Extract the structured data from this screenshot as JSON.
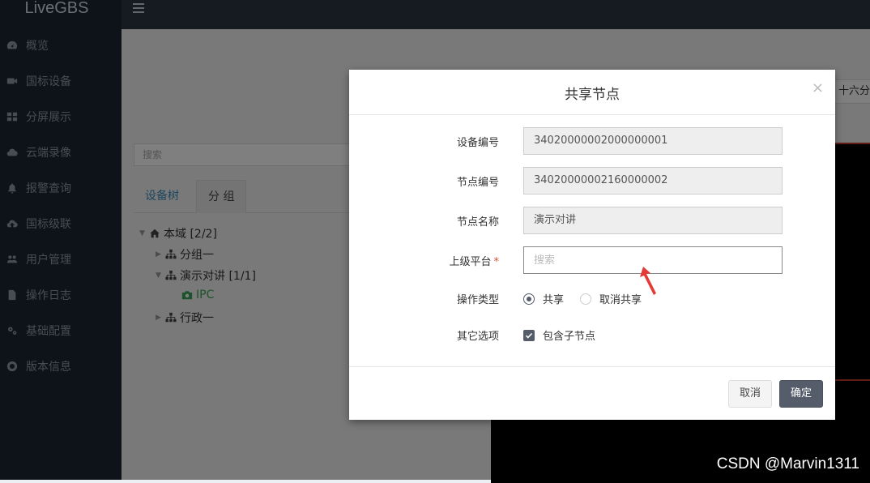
{
  "app": {
    "title": "LiveGBS"
  },
  "sidebar": {
    "items": [
      {
        "label": "概览",
        "icon": "dashboard-icon"
      },
      {
        "label": "国标设备",
        "icon": "video-camera-icon"
      },
      {
        "label": "分屏展示",
        "icon": "grid-icon"
      },
      {
        "label": "云端录像",
        "icon": "cloud-icon"
      },
      {
        "label": "报警查询",
        "icon": "bell-icon"
      },
      {
        "label": "国标级联",
        "icon": "cloud-upload-icon"
      },
      {
        "label": "用户管理",
        "icon": "users-icon"
      },
      {
        "label": "操作日志",
        "icon": "file-icon"
      },
      {
        "label": "基础配置",
        "icon": "gears-icon"
      },
      {
        "label": "版本信息",
        "icon": "lifebuoy-icon"
      }
    ]
  },
  "main": {
    "search_placeholder": "搜索",
    "tabs": [
      {
        "label": "设备树"
      },
      {
        "label": "分 组"
      }
    ],
    "tree": {
      "root": "本域 [2/2]",
      "group1": "分组一",
      "group2": "演示对讲 [1/1]",
      "ipc": "IPC",
      "group3": "行政一"
    },
    "right_button": "十六分"
  },
  "modal": {
    "title": "共享节点",
    "close_glyph": "×",
    "fields": {
      "device_id_label": "设备编号",
      "device_id_value": "34020000002000000001",
      "node_id_label": "节点编号",
      "node_id_value": "34020000002160000002",
      "node_name_label": "节点名称",
      "node_name_value": "演示对讲",
      "parent_label": "上级平台",
      "required_mark": "*",
      "parent_placeholder": "搜索",
      "parent_value": "",
      "op_type_label": "操作类型",
      "op_share": "共享",
      "op_cancel_share": "取消共享",
      "op_selected": "共享",
      "other_label": "其它选项",
      "include_children": "包含子节点",
      "include_children_checked": true
    },
    "buttons": {
      "cancel": "取消",
      "ok": "确定"
    }
  },
  "colors": {
    "sidebar_bg": "#1d2532",
    "topbar_bg": "#2d3644",
    "primary_button": "#555d6b",
    "required_red": "#dd4b39",
    "arrow_red": "#e53935",
    "ipc_green": "#3aa655",
    "tab_blue": "#3c8dbc"
  },
  "watermark": "CSDN @Marvin1311"
}
